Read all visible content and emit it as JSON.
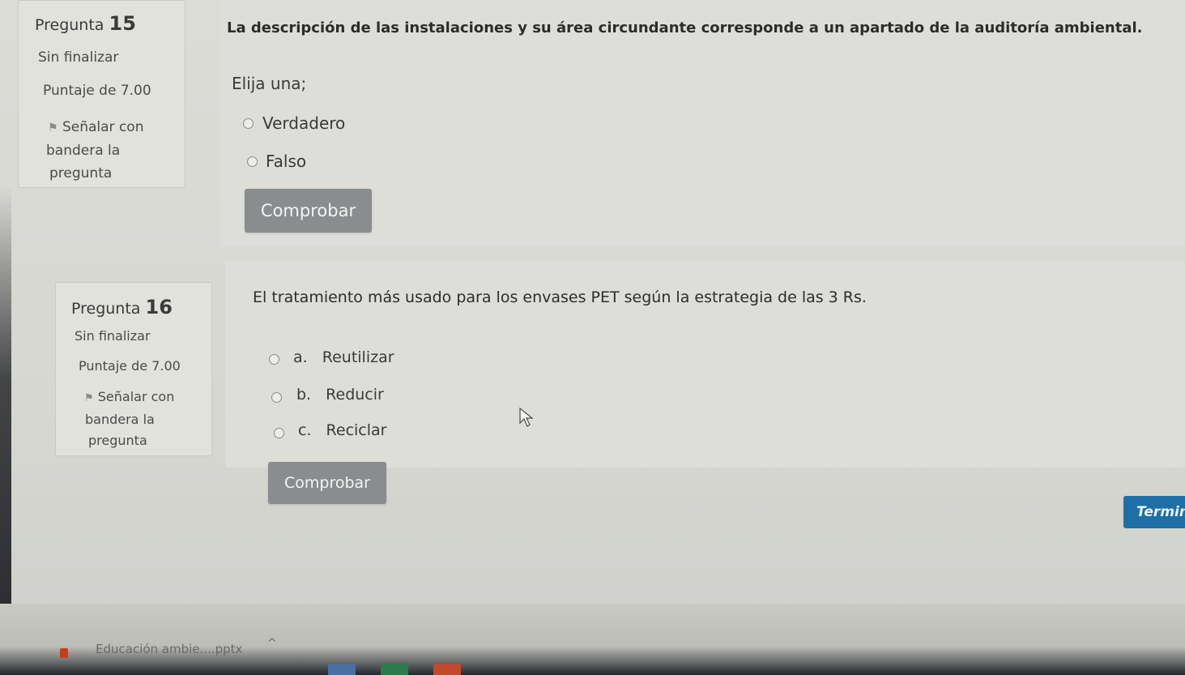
{
  "q15": {
    "label": "Pregunta",
    "number": "15",
    "status": "Sin finalizar",
    "score": "Puntaje de 7.00",
    "flag_line1": "Señalar con",
    "flag_line2": "bandera la",
    "flag_line3": "pregunta",
    "text": "La descripción de las instalaciones y su área circundante corresponde a un apartado de la auditoría ambiental.",
    "prompt": "Elija una;",
    "options": [
      "Verdadero",
      "Falso"
    ],
    "check_button": "Comprobar"
  },
  "q16": {
    "label": "Pregunta",
    "number": "16",
    "status": "Sin finalizar",
    "score": "Puntaje de 7.00",
    "flag_line1": "Señalar con",
    "flag_line2": "bandera la",
    "flag_line3": "pregunta",
    "text": "El tratamiento más usado para los envases PET según la estrategia de las 3 Rs.",
    "options": [
      {
        "letter": "a.",
        "label": "Reutilizar"
      },
      {
        "letter": "b.",
        "label": "Reducir"
      },
      {
        "letter": "c.",
        "label": "Reciclar"
      }
    ],
    "check_button": "Comprobar"
  },
  "finish_button": "Termina",
  "download": {
    "filename": "Educación ambie....pptx",
    "icon": "powerpoint-file-icon"
  },
  "colors": {
    "button_gray": "#8a8d90",
    "finish_blue": "#1d6fa8"
  }
}
